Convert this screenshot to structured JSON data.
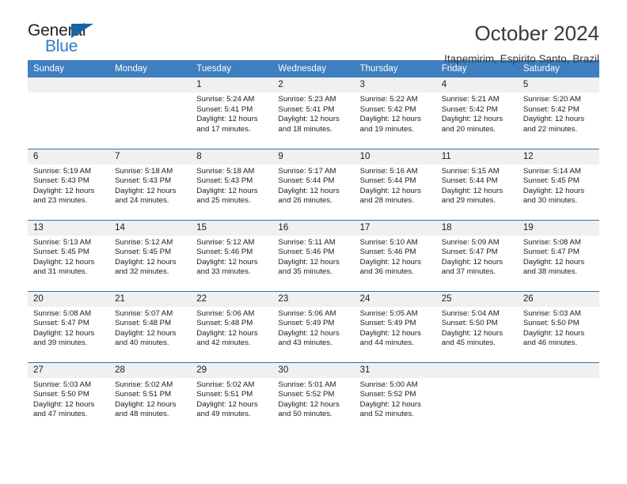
{
  "logo": {
    "word_top": "General",
    "word_bottom": "Blue",
    "triangle_color": "#1565a8",
    "blue_color": "#2b7cc4"
  },
  "header": {
    "month_title": "October 2024",
    "location": "Itapemirim, Espirito Santo, Brazil"
  },
  "theme": {
    "header_bar": "#3f7fbf",
    "row_divider": "#2f72ad",
    "daynum_band": "#f0f0f0"
  },
  "calendar": {
    "day_headers": [
      "Sunday",
      "Monday",
      "Tuesday",
      "Wednesday",
      "Thursday",
      "Friday",
      "Saturday"
    ],
    "weeks": [
      [
        {
          "day": "",
          "lines": []
        },
        {
          "day": "",
          "lines": []
        },
        {
          "day": "1",
          "lines": [
            "Sunrise: 5:24 AM",
            "Sunset: 5:41 PM",
            "Daylight: 12 hours",
            "and 17 minutes."
          ]
        },
        {
          "day": "2",
          "lines": [
            "Sunrise: 5:23 AM",
            "Sunset: 5:41 PM",
            "Daylight: 12 hours",
            "and 18 minutes."
          ]
        },
        {
          "day": "3",
          "lines": [
            "Sunrise: 5:22 AM",
            "Sunset: 5:42 PM",
            "Daylight: 12 hours",
            "and 19 minutes."
          ]
        },
        {
          "day": "4",
          "lines": [
            "Sunrise: 5:21 AM",
            "Sunset: 5:42 PM",
            "Daylight: 12 hours",
            "and 20 minutes."
          ]
        },
        {
          "day": "5",
          "lines": [
            "Sunrise: 5:20 AM",
            "Sunset: 5:42 PM",
            "Daylight: 12 hours",
            "and 22 minutes."
          ]
        }
      ],
      [
        {
          "day": "6",
          "lines": [
            "Sunrise: 5:19 AM",
            "Sunset: 5:43 PM",
            "Daylight: 12 hours",
            "and 23 minutes."
          ]
        },
        {
          "day": "7",
          "lines": [
            "Sunrise: 5:18 AM",
            "Sunset: 5:43 PM",
            "Daylight: 12 hours",
            "and 24 minutes."
          ]
        },
        {
          "day": "8",
          "lines": [
            "Sunrise: 5:18 AM",
            "Sunset: 5:43 PM",
            "Daylight: 12 hours",
            "and 25 minutes."
          ]
        },
        {
          "day": "9",
          "lines": [
            "Sunrise: 5:17 AM",
            "Sunset: 5:44 PM",
            "Daylight: 12 hours",
            "and 26 minutes."
          ]
        },
        {
          "day": "10",
          "lines": [
            "Sunrise: 5:16 AM",
            "Sunset: 5:44 PM",
            "Daylight: 12 hours",
            "and 28 minutes."
          ]
        },
        {
          "day": "11",
          "lines": [
            "Sunrise: 5:15 AM",
            "Sunset: 5:44 PM",
            "Daylight: 12 hours",
            "and 29 minutes."
          ]
        },
        {
          "day": "12",
          "lines": [
            "Sunrise: 5:14 AM",
            "Sunset: 5:45 PM",
            "Daylight: 12 hours",
            "and 30 minutes."
          ]
        }
      ],
      [
        {
          "day": "13",
          "lines": [
            "Sunrise: 5:13 AM",
            "Sunset: 5:45 PM",
            "Daylight: 12 hours",
            "and 31 minutes."
          ]
        },
        {
          "day": "14",
          "lines": [
            "Sunrise: 5:12 AM",
            "Sunset: 5:45 PM",
            "Daylight: 12 hours",
            "and 32 minutes."
          ]
        },
        {
          "day": "15",
          "lines": [
            "Sunrise: 5:12 AM",
            "Sunset: 5:46 PM",
            "Daylight: 12 hours",
            "and 33 minutes."
          ]
        },
        {
          "day": "16",
          "lines": [
            "Sunrise: 5:11 AM",
            "Sunset: 5:46 PM",
            "Daylight: 12 hours",
            "and 35 minutes."
          ]
        },
        {
          "day": "17",
          "lines": [
            "Sunrise: 5:10 AM",
            "Sunset: 5:46 PM",
            "Daylight: 12 hours",
            "and 36 minutes."
          ]
        },
        {
          "day": "18",
          "lines": [
            "Sunrise: 5:09 AM",
            "Sunset: 5:47 PM",
            "Daylight: 12 hours",
            "and 37 minutes."
          ]
        },
        {
          "day": "19",
          "lines": [
            "Sunrise: 5:08 AM",
            "Sunset: 5:47 PM",
            "Daylight: 12 hours",
            "and 38 minutes."
          ]
        }
      ],
      [
        {
          "day": "20",
          "lines": [
            "Sunrise: 5:08 AM",
            "Sunset: 5:47 PM",
            "Daylight: 12 hours",
            "and 39 minutes."
          ]
        },
        {
          "day": "21",
          "lines": [
            "Sunrise: 5:07 AM",
            "Sunset: 5:48 PM",
            "Daylight: 12 hours",
            "and 40 minutes."
          ]
        },
        {
          "day": "22",
          "lines": [
            "Sunrise: 5:06 AM",
            "Sunset: 5:48 PM",
            "Daylight: 12 hours",
            "and 42 minutes."
          ]
        },
        {
          "day": "23",
          "lines": [
            "Sunrise: 5:06 AM",
            "Sunset: 5:49 PM",
            "Daylight: 12 hours",
            "and 43 minutes."
          ]
        },
        {
          "day": "24",
          "lines": [
            "Sunrise: 5:05 AM",
            "Sunset: 5:49 PM",
            "Daylight: 12 hours",
            "and 44 minutes."
          ]
        },
        {
          "day": "25",
          "lines": [
            "Sunrise: 5:04 AM",
            "Sunset: 5:50 PM",
            "Daylight: 12 hours",
            "and 45 minutes."
          ]
        },
        {
          "day": "26",
          "lines": [
            "Sunrise: 5:03 AM",
            "Sunset: 5:50 PM",
            "Daylight: 12 hours",
            "and 46 minutes."
          ]
        }
      ],
      [
        {
          "day": "27",
          "lines": [
            "Sunrise: 5:03 AM",
            "Sunset: 5:50 PM",
            "Daylight: 12 hours",
            "and 47 minutes."
          ]
        },
        {
          "day": "28",
          "lines": [
            "Sunrise: 5:02 AM",
            "Sunset: 5:51 PM",
            "Daylight: 12 hours",
            "and 48 minutes."
          ]
        },
        {
          "day": "29",
          "lines": [
            "Sunrise: 5:02 AM",
            "Sunset: 5:51 PM",
            "Daylight: 12 hours",
            "and 49 minutes."
          ]
        },
        {
          "day": "30",
          "lines": [
            "Sunrise: 5:01 AM",
            "Sunset: 5:52 PM",
            "Daylight: 12 hours",
            "and 50 minutes."
          ]
        },
        {
          "day": "31",
          "lines": [
            "Sunrise: 5:00 AM",
            "Sunset: 5:52 PM",
            "Daylight: 12 hours",
            "and 52 minutes."
          ]
        },
        {
          "day": "",
          "lines": []
        },
        {
          "day": "",
          "lines": []
        }
      ]
    ]
  }
}
